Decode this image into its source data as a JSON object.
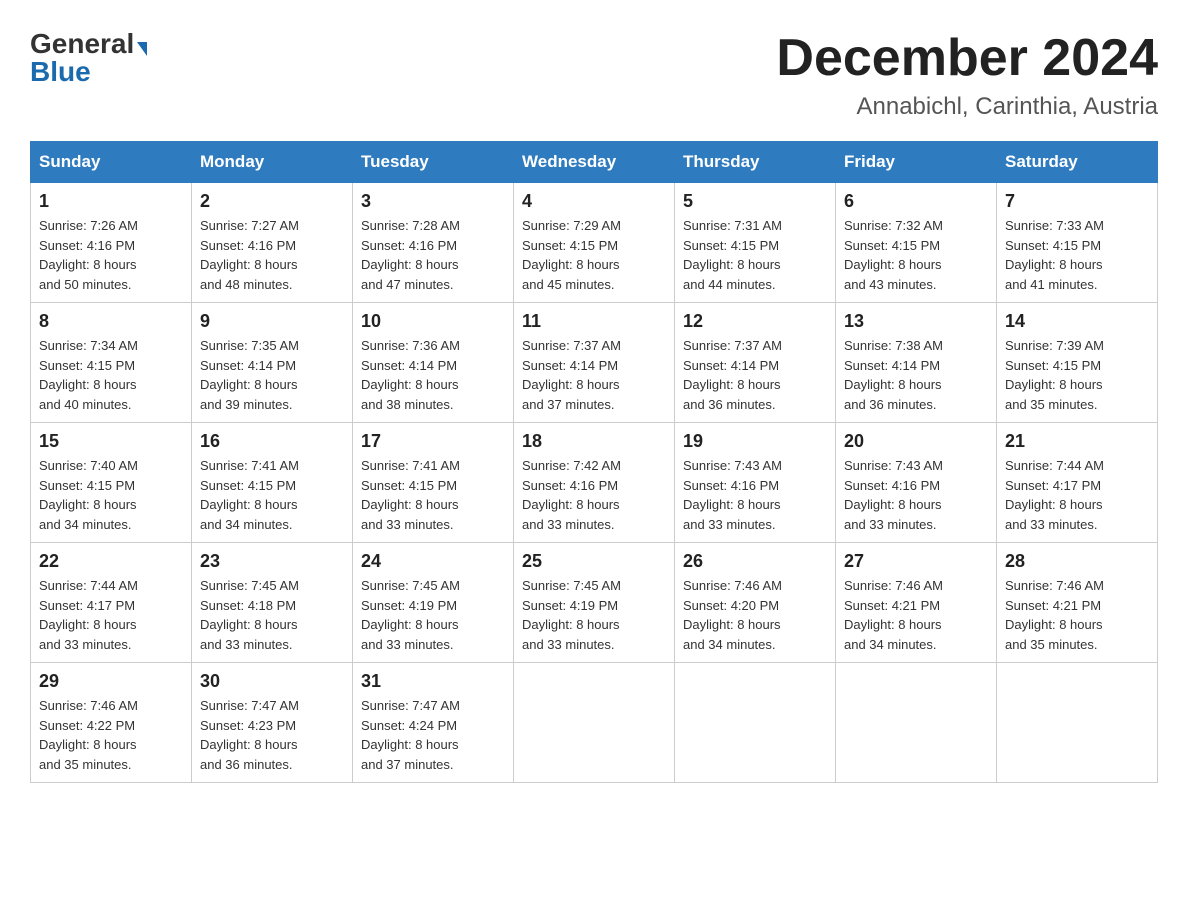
{
  "logo": {
    "general": "General",
    "blue": "Blue"
  },
  "header": {
    "month_year": "December 2024",
    "location": "Annabichl, Carinthia, Austria"
  },
  "weekdays": [
    "Sunday",
    "Monday",
    "Tuesday",
    "Wednesday",
    "Thursday",
    "Friday",
    "Saturday"
  ],
  "weeks": [
    [
      {
        "day": "1",
        "sunrise": "7:26 AM",
        "sunset": "4:16 PM",
        "daylight": "8 hours and 50 minutes."
      },
      {
        "day": "2",
        "sunrise": "7:27 AM",
        "sunset": "4:16 PM",
        "daylight": "8 hours and 48 minutes."
      },
      {
        "day": "3",
        "sunrise": "7:28 AM",
        "sunset": "4:16 PM",
        "daylight": "8 hours and 47 minutes."
      },
      {
        "day": "4",
        "sunrise": "7:29 AM",
        "sunset": "4:15 PM",
        "daylight": "8 hours and 45 minutes."
      },
      {
        "day": "5",
        "sunrise": "7:31 AM",
        "sunset": "4:15 PM",
        "daylight": "8 hours and 44 minutes."
      },
      {
        "day": "6",
        "sunrise": "7:32 AM",
        "sunset": "4:15 PM",
        "daylight": "8 hours and 43 minutes."
      },
      {
        "day": "7",
        "sunrise": "7:33 AM",
        "sunset": "4:15 PM",
        "daylight": "8 hours and 41 minutes."
      }
    ],
    [
      {
        "day": "8",
        "sunrise": "7:34 AM",
        "sunset": "4:15 PM",
        "daylight": "8 hours and 40 minutes."
      },
      {
        "day": "9",
        "sunrise": "7:35 AM",
        "sunset": "4:14 PM",
        "daylight": "8 hours and 39 minutes."
      },
      {
        "day": "10",
        "sunrise": "7:36 AM",
        "sunset": "4:14 PM",
        "daylight": "8 hours and 38 minutes."
      },
      {
        "day": "11",
        "sunrise": "7:37 AM",
        "sunset": "4:14 PM",
        "daylight": "8 hours and 37 minutes."
      },
      {
        "day": "12",
        "sunrise": "7:37 AM",
        "sunset": "4:14 PM",
        "daylight": "8 hours and 36 minutes."
      },
      {
        "day": "13",
        "sunrise": "7:38 AM",
        "sunset": "4:14 PM",
        "daylight": "8 hours and 36 minutes."
      },
      {
        "day": "14",
        "sunrise": "7:39 AM",
        "sunset": "4:15 PM",
        "daylight": "8 hours and 35 minutes."
      }
    ],
    [
      {
        "day": "15",
        "sunrise": "7:40 AM",
        "sunset": "4:15 PM",
        "daylight": "8 hours and 34 minutes."
      },
      {
        "day": "16",
        "sunrise": "7:41 AM",
        "sunset": "4:15 PM",
        "daylight": "8 hours and 34 minutes."
      },
      {
        "day": "17",
        "sunrise": "7:41 AM",
        "sunset": "4:15 PM",
        "daylight": "8 hours and 33 minutes."
      },
      {
        "day": "18",
        "sunrise": "7:42 AM",
        "sunset": "4:16 PM",
        "daylight": "8 hours and 33 minutes."
      },
      {
        "day": "19",
        "sunrise": "7:43 AM",
        "sunset": "4:16 PM",
        "daylight": "8 hours and 33 minutes."
      },
      {
        "day": "20",
        "sunrise": "7:43 AM",
        "sunset": "4:16 PM",
        "daylight": "8 hours and 33 minutes."
      },
      {
        "day": "21",
        "sunrise": "7:44 AM",
        "sunset": "4:17 PM",
        "daylight": "8 hours and 33 minutes."
      }
    ],
    [
      {
        "day": "22",
        "sunrise": "7:44 AM",
        "sunset": "4:17 PM",
        "daylight": "8 hours and 33 minutes."
      },
      {
        "day": "23",
        "sunrise": "7:45 AM",
        "sunset": "4:18 PM",
        "daylight": "8 hours and 33 minutes."
      },
      {
        "day": "24",
        "sunrise": "7:45 AM",
        "sunset": "4:19 PM",
        "daylight": "8 hours and 33 minutes."
      },
      {
        "day": "25",
        "sunrise": "7:45 AM",
        "sunset": "4:19 PM",
        "daylight": "8 hours and 33 minutes."
      },
      {
        "day": "26",
        "sunrise": "7:46 AM",
        "sunset": "4:20 PM",
        "daylight": "8 hours and 34 minutes."
      },
      {
        "day": "27",
        "sunrise": "7:46 AM",
        "sunset": "4:21 PM",
        "daylight": "8 hours and 34 minutes."
      },
      {
        "day": "28",
        "sunrise": "7:46 AM",
        "sunset": "4:21 PM",
        "daylight": "8 hours and 35 minutes."
      }
    ],
    [
      {
        "day": "29",
        "sunrise": "7:46 AM",
        "sunset": "4:22 PM",
        "daylight": "8 hours and 35 minutes."
      },
      {
        "day": "30",
        "sunrise": "7:47 AM",
        "sunset": "4:23 PM",
        "daylight": "8 hours and 36 minutes."
      },
      {
        "day": "31",
        "sunrise": "7:47 AM",
        "sunset": "4:24 PM",
        "daylight": "8 hours and 37 minutes."
      },
      null,
      null,
      null,
      null
    ]
  ],
  "labels": {
    "sunrise": "Sunrise:",
    "sunset": "Sunset:",
    "daylight": "Daylight:"
  }
}
